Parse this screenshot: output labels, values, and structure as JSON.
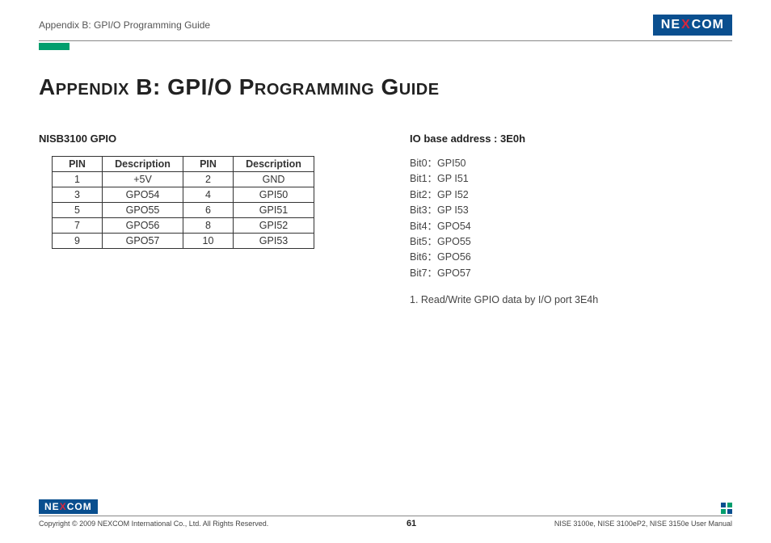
{
  "header": {
    "title": "Appendix B: GPI/O Programming Guide",
    "logo_parts": {
      "pre": "NE",
      "x": "X",
      "post": "COM"
    }
  },
  "page_title": "Appendix B: GPI/O Programming Guide",
  "left": {
    "section_head": "NISB3100 GPIO",
    "table_headers": [
      "PIN",
      "Description",
      "PIN",
      "Description"
    ],
    "rows": [
      {
        "pin1": "1",
        "desc1": "+5V",
        "pin2": "2",
        "desc2": "GND"
      },
      {
        "pin1": "3",
        "desc1": "GPO54",
        "pin2": "4",
        "desc2": "GPI50"
      },
      {
        "pin1": "5",
        "desc1": "GPO55",
        "pin2": "6",
        "desc2": "GPI51"
      },
      {
        "pin1": "7",
        "desc1": "GPO56",
        "pin2": "8",
        "desc2": "GPI52"
      },
      {
        "pin1": "9",
        "desc1": "GPO57",
        "pin2": "10",
        "desc2": "GPI53"
      }
    ]
  },
  "right": {
    "section_head": "IO base address : 3E0h",
    "bits": [
      "Bit0：GPI50",
      "Bit1：GP I51",
      "Bit2：GP I52",
      "Bit3：GP I53",
      "Bit4：GPO54",
      "Bit5：GPO55",
      "Bit6：GPO56",
      "Bit7：GPO57"
    ],
    "note": "1. Read/Write GPIO data by I/O port 3E4h"
  },
  "footer": {
    "logo_parts": {
      "pre": "NE",
      "x": "X",
      "post": "COM"
    },
    "copyright": "Copyright © 2009 NEXCOM International Co., Ltd. All Rights Reserved.",
    "page_number": "61",
    "manual_ref": "NISE 3100e, NISE 3100eP2, NISE 3150e User Manual"
  }
}
